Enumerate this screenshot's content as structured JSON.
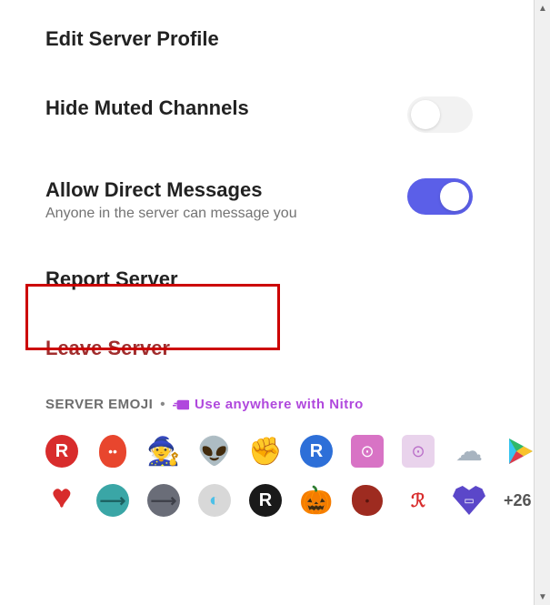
{
  "menu": {
    "editProfile": "Edit Server Profile",
    "hideMuted": "Hide Muted Channels",
    "hideMutedToggled": false,
    "allowDM": "Allow Direct Messages",
    "allowDMSub": "Anyone in the server can message you",
    "allowDMToggled": true,
    "reportServer": "Report Server",
    "leaveServer": "Leave Server"
  },
  "emojiSection": {
    "header": "SERVER EMOJI",
    "nitroText": "Use anywhere with Nitro",
    "moreCount": "+26",
    "row1": [
      {
        "name": "r-white-on-red",
        "bg": "#d82c2c",
        "fg": "#fff",
        "glyph": "R",
        "shape": "circle"
      },
      {
        "name": "red-blob-face",
        "bg": "#e8462e",
        "fg": "#fff",
        "glyph": "◉",
        "shape": "egg"
      },
      {
        "name": "wizard-purple",
        "bg": "",
        "fg": "#4a3b6e",
        "glyph": "🧙",
        "shape": "none"
      },
      {
        "name": "alien-green",
        "bg": "",
        "fg": "#6db84c",
        "glyph": "👽",
        "shape": "none"
      },
      {
        "name": "raised-fist",
        "bg": "",
        "fg": "#1a1a1a",
        "glyph": "✊",
        "shape": "none"
      },
      {
        "name": "r-blue-circle",
        "bg": "#2d6fd8",
        "fg": "#fff",
        "glyph": "R",
        "shape": "circle"
      },
      {
        "name": "nitro-pink-square",
        "bg": "#d873c5",
        "fg": "#fff",
        "glyph": "⟶",
        "shape": "square"
      },
      {
        "name": "nitro-light-square",
        "bg": "#e9d3ec",
        "fg": "#b96dc8",
        "glyph": "⟶",
        "shape": "square"
      },
      {
        "name": "cloud-creature",
        "bg": "",
        "fg": "#a8b4c0",
        "glyph": "☁",
        "shape": "none"
      },
      {
        "name": "play-triangle",
        "bg": "",
        "fg": "",
        "glyph": "play",
        "shape": "play"
      }
    ],
    "row2": [
      {
        "name": "pixel-heart",
        "bg": "",
        "fg": "#d82c2c",
        "glyph": "♥",
        "shape": "pixel"
      },
      {
        "name": "nitro-teal-circle",
        "bg": "#3aa6a6",
        "fg": "#1b5f5f",
        "glyph": "⟶",
        "shape": "circle"
      },
      {
        "name": "nitro-gray-circle",
        "bg": "#6a6d78",
        "fg": "#3d3f48",
        "glyph": "⟶",
        "shape": "circle"
      },
      {
        "name": "q-halo-gray",
        "bg": "#d8d8d8",
        "fg": "#4cc0e8",
        "glyph": "◐",
        "shape": "circle"
      },
      {
        "name": "r-black-circle",
        "bg": "#1a1a1a",
        "fg": "#fff",
        "glyph": "R",
        "shape": "circle"
      },
      {
        "name": "pumpkin",
        "bg": "",
        "fg": "#d8733a",
        "glyph": "🎃",
        "shape": "none"
      },
      {
        "name": "red-blob-dark",
        "bg": "#9e2b20",
        "fg": "#5a150e",
        "glyph": "◉",
        "shape": "blob"
      },
      {
        "name": "r-cursive-red",
        "bg": "#ffffff",
        "fg": "#d82c2c",
        "glyph": "ℛ",
        "shape": "circle"
      },
      {
        "name": "purple-cassette",
        "bg": "#5b47c9",
        "fg": "#fff",
        "glyph": "▭",
        "shape": "heart"
      }
    ]
  },
  "colors": {
    "danger": "#a12d2d",
    "toggleOn": "#5b5fe8",
    "nitro": "#b048dd",
    "highlight": "#cc0000"
  }
}
